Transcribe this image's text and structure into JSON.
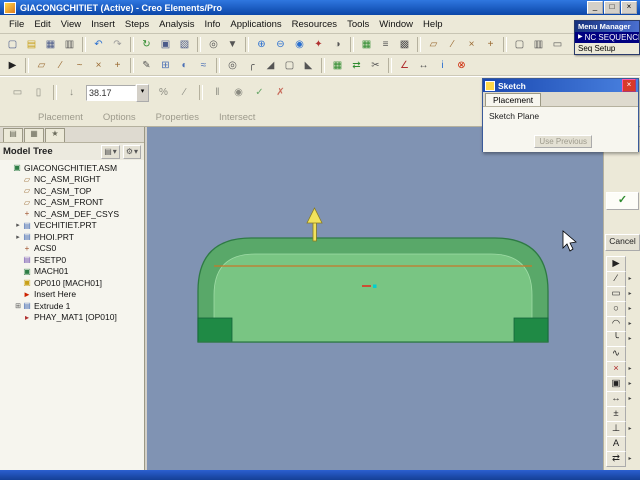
{
  "window": {
    "title": "GIACONGCHITIET (Active) - Creo Elements/Pro"
  },
  "window_controls": {
    "minimize": "_",
    "maximize": "□",
    "close": "×"
  },
  "menu": {
    "items": [
      "File",
      "Edit",
      "View",
      "Insert",
      "Steps",
      "Analysis",
      "Info",
      "Applications",
      "Resources",
      "Tools",
      "Window",
      "Help"
    ]
  },
  "toolbar_row1": [
    {
      "name": "new-file-icon",
      "glyph": "▢",
      "color": "#4a5a8a"
    },
    {
      "name": "open-icon",
      "glyph": "▤",
      "color": "#c8a018"
    },
    {
      "name": "save-icon",
      "glyph": "▦",
      "color": "#4a5a8a"
    },
    {
      "name": "print-icon",
      "glyph": "▥",
      "color": "#555555"
    },
    {
      "divider": true
    },
    {
      "name": "undo-icon",
      "glyph": "↶",
      "color": "#2a6fd0"
    },
    {
      "name": "redo-icon",
      "glyph": "↷",
      "color": "#999999"
    },
    {
      "divider": true
    },
    {
      "name": "regenerate-icon",
      "glyph": "↻",
      "color": "#2e8b2e"
    },
    {
      "name": "copy-icon",
      "glyph": "▣",
      "color": "#4a5a8a"
    },
    {
      "name": "paste-icon",
      "glyph": "▧",
      "color": "#4a5a8a"
    },
    {
      "divider": true
    },
    {
      "name": "search-icon",
      "glyph": "◎",
      "color": "#555555"
    },
    {
      "name": "select-filter-icon",
      "glyph": "▼",
      "color": "#555555"
    },
    {
      "divider": true
    },
    {
      "name": "zoom-in-icon",
      "glyph": "⊕",
      "color": "#2a6fd0"
    },
    {
      "name": "zoom-out-icon",
      "glyph": "⊖",
      "color": "#2a6fd0"
    },
    {
      "name": "refit-icon",
      "glyph": "◉",
      "color": "#2a6fd0"
    },
    {
      "name": "repaint-icon",
      "glyph": "✦",
      "color": "#b03030"
    },
    {
      "name": "orient-icon",
      "glyph": "◑",
      "color": "#555555"
    },
    {
      "divider": true
    },
    {
      "name": "saved-views-icon",
      "glyph": "▦",
      "color": "#2e8b2e"
    },
    {
      "name": "layers-icon",
      "glyph": "≡",
      "color": "#555555"
    },
    {
      "name": "view-manager-icon",
      "glyph": "▩",
      "color": "#555555"
    },
    {
      "divider": true
    },
    {
      "name": "datum-plane-toggle-icon",
      "glyph": "▱",
      "color": "#9a6a32"
    },
    {
      "name": "datum-axis-toggle-icon",
      "glyph": "∕",
      "color": "#9a6a32"
    },
    {
      "name": "datum-point-toggle-icon",
      "glyph": "×",
      "color": "#9a6a32"
    },
    {
      "name": "csys-toggle-icon",
      "glyph": "+",
      "color": "#9a6a32"
    },
    {
      "divider": true
    },
    {
      "name": "wireframe-icon",
      "glyph": "▢",
      "color": "#555555"
    },
    {
      "name": "hidden-line-icon",
      "glyph": "▥",
      "color": "#555555"
    },
    {
      "name": "no-hidden-icon",
      "glyph": "▭",
      "color": "#555555"
    },
    {
      "name": "shaded-icon",
      "glyph": "■",
      "color": "#4a6fb5"
    }
  ],
  "toolbar_row2": [
    {
      "name": "select-arrow-icon",
      "glyph": "▶",
      "color": "#222222"
    },
    {
      "divider": true
    },
    {
      "name": "datum-plane-icon",
      "glyph": "▱",
      "color": "#9a6a32"
    },
    {
      "name": "datum-axis-icon",
      "glyph": "∕",
      "color": "#9a6a32"
    },
    {
      "name": "datum-curve-icon",
      "glyph": "~",
      "color": "#9a6a32"
    },
    {
      "name": "datum-point-icon",
      "glyph": "×",
      "color": "#9a6a32"
    },
    {
      "name": "datum-csys-icon",
      "glyph": "+",
      "color": "#9a6a32"
    },
    {
      "divider": true
    },
    {
      "name": "sketch-tool-icon",
      "glyph": "✎",
      "color": "#555555"
    },
    {
      "name": "extrude-tool-icon",
      "glyph": "⊞",
      "color": "#4a6fb5"
    },
    {
      "name": "revolve-tool-icon",
      "glyph": "◐",
      "color": "#4a6fb5"
    },
    {
      "name": "sweep-tool-icon",
      "glyph": "≈",
      "color": "#4a6fb5"
    },
    {
      "divider": true
    },
    {
      "name": "hole-tool-icon",
      "glyph": "◎",
      "color": "#555555"
    },
    {
      "name": "round-tool-icon",
      "glyph": "╭",
      "color": "#555555"
    },
    {
      "name": "chamfer-tool-icon",
      "glyph": "◢",
      "color": "#555555"
    },
    {
      "name": "shell-tool-icon",
      "glyph": "▢",
      "color": "#555555"
    },
    {
      "name": "draft-tool-icon",
      "glyph": "◣",
      "color": "#555555"
    },
    {
      "divider": true
    },
    {
      "name": "pattern-tool-icon",
      "glyph": "▦",
      "color": "#2e8b2e"
    },
    {
      "name": "mirror-tool-icon",
      "glyph": "⇄",
      "color": "#2e8b2e"
    },
    {
      "name": "trim-tool-icon",
      "glyph": "✂",
      "color": "#555555"
    },
    {
      "divider": true
    },
    {
      "name": "analysis-icon",
      "glyph": "∠",
      "color": "#b03030"
    },
    {
      "name": "measure-icon",
      "glyph": "↔",
      "color": "#555555"
    },
    {
      "name": "info-icon",
      "glyph": "i",
      "color": "#2a6fd0"
    },
    {
      "name": "stop-icon",
      "glyph": "⊗",
      "color": "#cc2200"
    }
  ],
  "dashboard": {
    "depth_value": "38.17",
    "tabs": [
      "Placement",
      "Options",
      "Properties",
      "Intersect"
    ],
    "icons": [
      {
        "name": "solid-feature-icon",
        "glyph": "▭",
        "color": "#8a8a80"
      },
      {
        "name": "surface-feature-icon",
        "glyph": "▯",
        "color": "#8a8a80"
      },
      {
        "divider": true
      },
      {
        "name": "depth-type-icon",
        "glyph": "↓",
        "color": "#8a8a80"
      },
      {
        "combo": true
      },
      {
        "name": "flip-direction-icon",
        "glyph": "%",
        "color": "#8a8a80"
      },
      {
        "name": "remove-material-icon",
        "glyph": "∕",
        "color": "#8a8a80"
      },
      {
        "divider": true
      },
      {
        "name": "pause-icon",
        "glyph": "‖",
        "color": "#8a8a80"
      },
      {
        "name": "preview-icon",
        "glyph": "◉",
        "color": "#8a8a80"
      },
      {
        "name": "apply-icon",
        "glyph": "✓",
        "color": "#6aa86a"
      },
      {
        "name": "cancel-feature-icon",
        "glyph": "✗",
        "color": "#c86a5a"
      }
    ]
  },
  "menu_manager": {
    "title": "Menu Manager",
    "items": [
      {
        "label": "NC SEQUENCE",
        "selected": true
      },
      {
        "label": "Seq Setup",
        "selected": false
      }
    ]
  },
  "sketch_dialog": {
    "title": "Sketch",
    "close": "×",
    "tab": "Placement",
    "sketch_plane_label": "Sketch Plane",
    "use_previous_label": "Use Previous"
  },
  "right_panel": {
    "ok_glyph": "✓",
    "cancel_label": "Cancel",
    "tools": [
      {
        "name": "select-tool-icon",
        "glyph": "▶",
        "color": "#222222",
        "flyout": false
      },
      {
        "name": "line-tool-icon",
        "glyph": "∕",
        "color": "#222222",
        "flyout": true
      },
      {
        "name": "rectangle-tool-icon",
        "glyph": "▭",
        "color": "#222222",
        "flyout": true
      },
      {
        "name": "circle-tool-icon",
        "glyph": "○",
        "color": "#222222",
        "flyout": true
      },
      {
        "name": "arc-tool-icon",
        "glyph": "◠",
        "color": "#222222",
        "flyout": true
      },
      {
        "name": "fillet-tool-icon",
        "glyph": "╰",
        "color": "#222222",
        "flyout": true
      },
      {
        "name": "spline-tool-icon",
        "glyph": "∿",
        "color": "#222222",
        "flyout": false
      },
      {
        "name": "point-tool-icon",
        "glyph": "×",
        "color": "#b03030",
        "flyout": true
      },
      {
        "name": "use-edge-tool-icon",
        "glyph": "▣",
        "color": "#222222",
        "flyout": true
      },
      {
        "name": "dimension-tool-icon",
        "glyph": "↔",
        "color": "#222222",
        "flyout": true
      },
      {
        "name": "modify-tool-icon",
        "glyph": "±",
        "color": "#222222",
        "flyout": false
      },
      {
        "name": "constraint-tool-icon",
        "glyph": "⊥",
        "color": "#222222",
        "flyout": true
      },
      {
        "name": "text-tool-icon",
        "glyph": "A",
        "color": "#222222",
        "flyout": false
      },
      {
        "name": "mirror-sketch-icon",
        "glyph": "⇄",
        "color": "#222222",
        "flyout": true
      }
    ]
  },
  "model_tree": {
    "header": "Model Tree",
    "icon_styles": {
      "asm": {
        "glyph": "▣",
        "color": "#2e7d46"
      },
      "datum-plane": {
        "glyph": "▱",
        "color": "#9a6a32"
      },
      "csys": {
        "glyph": "+",
        "color": "#a0522d"
      },
      "part": {
        "glyph": "▤",
        "color": "#4a6fb5"
      },
      "fixture": {
        "glyph": "▤",
        "color": "#7a5ab5"
      },
      "machine": {
        "glyph": "▣",
        "color": "#2e7d46"
      },
      "operation": {
        "glyph": "▣",
        "color": "#c8a018"
      },
      "insert-here": {
        "glyph": "►",
        "color": "#cc2200"
      },
      "extrude": {
        "glyph": "▤",
        "color": "#4a6fb5"
      },
      "nc-sequence": {
        "glyph": "▸",
        "color": "#b03030"
      }
    },
    "items": [
      {
        "label": "GIACONGCHITIET.ASM",
        "icon": "asm",
        "indent": 0,
        "expander": ""
      },
      {
        "label": "NC_ASM_RIGHT",
        "icon": "datum-plane",
        "indent": 1,
        "expander": ""
      },
      {
        "label": "NC_ASM_TOP",
        "icon": "datum-plane",
        "indent": 1,
        "expander": ""
      },
      {
        "label": "NC_ASM_FRONT",
        "icon": "datum-plane",
        "indent": 1,
        "expander": ""
      },
      {
        "label": "NC_ASM_DEF_CSYS",
        "icon": "csys",
        "indent": 1,
        "expander": ""
      },
      {
        "label": "VECHITIET.PRT",
        "icon": "part",
        "indent": 1,
        "expander": "▸"
      },
      {
        "label": "PHOI.PRT",
        "icon": "part",
        "indent": 1,
        "expander": "▸"
      },
      {
        "label": "ACS0",
        "icon": "csys",
        "indent": 1,
        "expander": ""
      },
      {
        "label": "FSETP0",
        "icon": "fixture",
        "indent": 1,
        "expander": ""
      },
      {
        "label": "MACH01",
        "icon": "machine",
        "indent": 1,
        "expander": ""
      },
      {
        "label": "OP010 [MACH01]",
        "icon": "operation",
        "indent": 1,
        "expander": ""
      },
      {
        "label": "Insert Here",
        "icon": "insert-here",
        "indent": 1,
        "expander": ""
      },
      {
        "label": "Extrude 1",
        "icon": "extrude",
        "indent": 1,
        "expander": "⊞"
      },
      {
        "label": "PHAY_MAT1 [OP010]",
        "icon": "nc-sequence",
        "indent": 1,
        "expander": ""
      }
    ]
  },
  "colors": {
    "graphics_bg": "#8093b3",
    "shape_green_dark": "#59a869",
    "shape_green": "#79c583",
    "shape_corner_green": "#1f8a45",
    "shape_outline": "#2e7a44",
    "sketch_line_orange": "#c87828",
    "arrow_yellow": "#f2e35c",
    "selection_navy": "#000080",
    "titlebar_blue": "#0f5bd5"
  }
}
